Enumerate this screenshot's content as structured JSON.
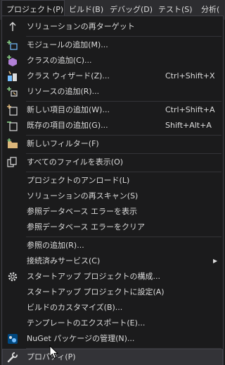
{
  "menubar": {
    "items": [
      {
        "label": "プロジェクト(P)",
        "active": true
      },
      {
        "label": "ビルド(B)"
      },
      {
        "label": "デバッグ(D)"
      },
      {
        "label": "テスト(S)"
      },
      {
        "label": "分析("
      }
    ]
  },
  "menu": {
    "items": [
      {
        "label": "ソリューションの再ターゲット",
        "icon": "arrow-up-icon"
      },
      {
        "label": "モジュールの追加(M)...",
        "icon": "add-module-icon"
      },
      {
        "label": "クラスの追加(C)...",
        "icon": "add-class-icon"
      },
      {
        "label": "クラス ウィザード(Z)...",
        "shortcut": "Ctrl+Shift+X",
        "icon": "class-wizard-icon"
      },
      {
        "label": "リソースの追加(R)...",
        "icon": "add-resource-icon"
      },
      {
        "label": "新しい項目の追加(W)...",
        "shortcut": "Ctrl+Shift+A",
        "icon": "new-item-icon"
      },
      {
        "label": "既存の項目の追加(G)...",
        "shortcut": "Shift+Alt+A",
        "icon": "existing-item-icon"
      },
      {
        "label": "新しいフィルター(F)",
        "icon": "folder-icon"
      },
      {
        "label": "すべてのファイルを表示(O)",
        "icon": "show-all-files-icon"
      },
      {
        "label": "プロジェクトのアンロード(L)"
      },
      {
        "label": "ソリューションの再スキャン(S)"
      },
      {
        "label": "参照データベース エラーを表示"
      },
      {
        "label": "参照データベース エラーをクリア"
      },
      {
        "label": "参照の追加(R)..."
      },
      {
        "label": "接続済みサービス(C)",
        "submenu": "▶"
      },
      {
        "label": "スタートアップ プロジェクトの構成...",
        "icon": "gear-icon"
      },
      {
        "label": "スタートアップ プロジェクトに設定(A)"
      },
      {
        "label": "ビルドのカスタマイズ(B)..."
      },
      {
        "label": "テンプレートのエクスポート(E)..."
      },
      {
        "label": "NuGet パッケージの管理(N)...",
        "icon": "nuget-icon"
      },
      {
        "label": "プロパティ(P)",
        "icon": "wrench-icon"
      }
    ]
  },
  "colors": {
    "background": "#1b1b1c",
    "menubar": "#2d2d30",
    "border": "#3f3f46",
    "hover": "#333337",
    "text": "#dcdcdc",
    "icon_blue": "#75beff",
    "icon_green": "#89d185",
    "icon_yellow": "#dcb67a"
  }
}
